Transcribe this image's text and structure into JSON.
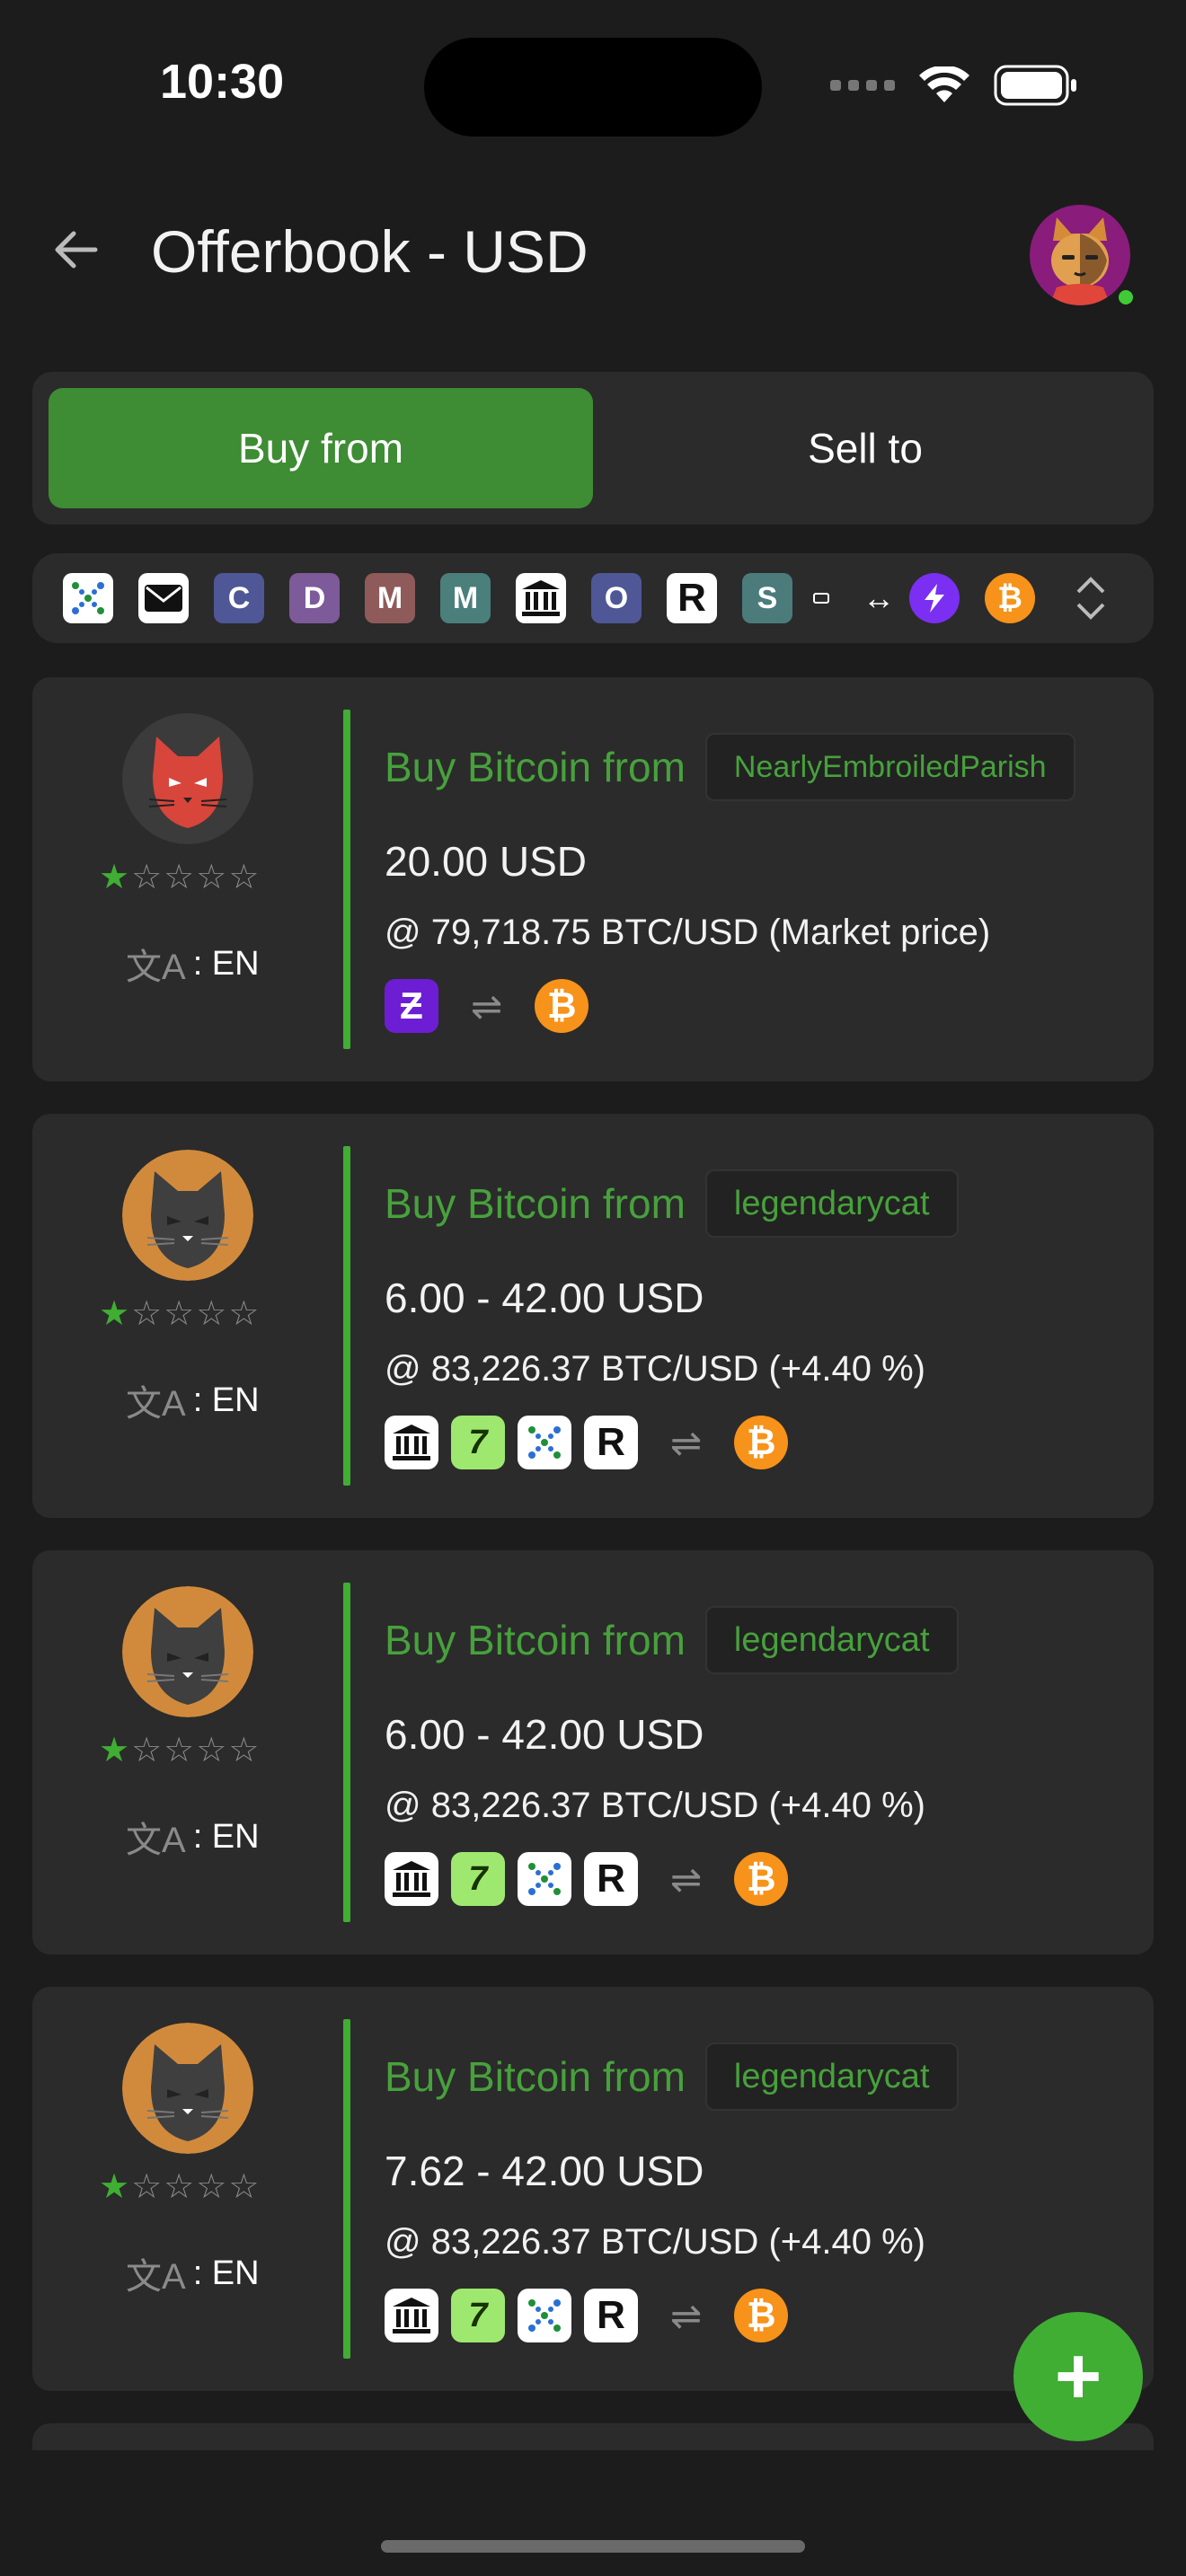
{
  "status_bar": {
    "time": "10:30"
  },
  "header": {
    "title": "Offerbook - USD"
  },
  "toggle": {
    "buy_label": "Buy from",
    "sell_label": "Sell to"
  },
  "filter": {
    "icons": [
      "strike-icon",
      "mail-icon",
      "c-letter-icon",
      "d-letter-icon",
      "m-letter-icon",
      "m-letter-icon-2",
      "bank-icon",
      "o-letter-icon",
      "revolut-icon",
      "s-letter-icon",
      "small-payment-icon",
      "swap-arrows-icon",
      "lightning-icon",
      "bitcoin-icon",
      "sort-chevrons-icon"
    ],
    "letters": {
      "c": "C",
      "d": "D",
      "m1": "M",
      "m2": "M",
      "o": "O",
      "r": "R",
      "s": "S"
    },
    "colors": {
      "c": "#4f5797",
      "d": "#7d5a9a",
      "m1": "#8f5a5a",
      "m2": "#4b7f7b",
      "o": "#4f5797",
      "s": "#4c7b7b",
      "lightning": "#7b2ff2",
      "bitcoin": "#f7931a"
    }
  },
  "offers": [
    {
      "buy_label": "Buy Bitcoin from",
      "user": "NearlyEmbroiledParish",
      "amount": "20.00 USD",
      "price": "@ 79,718.75 BTC/USD (Market price)",
      "lang_prefix": ": EN",
      "rating": 1,
      "methods": [
        "zelle"
      ]
    },
    {
      "buy_label": "Buy Bitcoin from",
      "user": "legendarycat",
      "amount": "6.00 - 42.00 USD",
      "price": "@ 83,226.37 BTC/USD (+4.40 %)",
      "lang_prefix": ": EN",
      "rating": 1,
      "methods": [
        "bank",
        "wise",
        "strike",
        "revolut"
      ]
    },
    {
      "buy_label": "Buy Bitcoin from",
      "user": "legendarycat",
      "amount": "6.00 - 42.00 USD",
      "price": "@ 83,226.37 BTC/USD (+4.40 %)",
      "lang_prefix": ": EN",
      "rating": 1,
      "methods": [
        "bank",
        "wise",
        "strike",
        "revolut"
      ]
    },
    {
      "buy_label": "Buy Bitcoin from",
      "user": "legendarycat",
      "amount": "7.62 - 42.00 USD",
      "price": "@ 83,226.37 BTC/USD (+4.40 %)",
      "lang_prefix": ": EN",
      "rating": 1,
      "methods": [
        "bank",
        "wise",
        "strike",
        "revolut"
      ]
    }
  ],
  "colors": {
    "accent": "#3fae33",
    "background": "#1c1c1c",
    "card": "#2b2b2b"
  }
}
